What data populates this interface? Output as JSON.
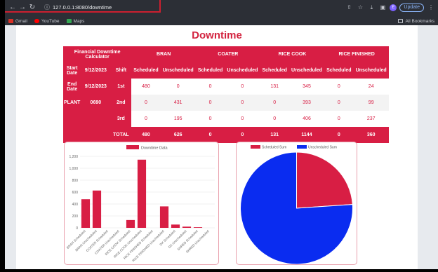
{
  "browser": {
    "url": "127.0.0.1:8080/downtime",
    "update_label": "Update",
    "profile_initial": "E",
    "bookmarks": [
      {
        "label": "Gmail",
        "color": "#d93025"
      },
      {
        "label": "YouTube",
        "color": "#ff0000"
      },
      {
        "label": "Maps",
        "color": "#34a853"
      }
    ],
    "all_bookmarks": "All Bookmarks"
  },
  "page": {
    "title": "Downtime"
  },
  "calculator": {
    "title": "Financial Downtime Calculator",
    "lines": [
      "BRAN",
      "COATER",
      "RICE COOK",
      "RICE FINISHED"
    ],
    "start_label": "Start Date",
    "start_date": "9/12/2023",
    "shift_label": "Shift",
    "scheduled": "Scheduled",
    "unscheduled": "Unscheduled",
    "end_label": "End Date",
    "end_date": "9/12/2023",
    "plant_label": "PLANT",
    "plant": "0690",
    "shifts": [
      {
        "name": "1st",
        "values": [
          "480",
          "0",
          "0",
          "0",
          "131",
          "345",
          "0",
          "24"
        ]
      },
      {
        "name": "2nd",
        "values": [
          "0",
          "431",
          "0",
          "0",
          "0",
          "393",
          "0",
          "99"
        ]
      },
      {
        "name": "3rd",
        "values": [
          "0",
          "195",
          "0",
          "0",
          "0",
          "406",
          "0",
          "237"
        ]
      }
    ],
    "total_label": "TOTAL",
    "totals": [
      "480",
      "626",
      "0",
      "0",
      "131",
      "1144",
      "0",
      "360"
    ]
  },
  "colors": {
    "crimson": "#d81e44",
    "blue": "#0a2cf0"
  },
  "chart_data": [
    {
      "type": "bar",
      "legend": [
        "Downtime Data"
      ],
      "categories": [
        "BRAN Scheduled",
        "BRAN Unscheduled",
        "COATER Scheduled",
        "COATER Unscheduled",
        "RICE COOK Scheduled",
        "RICE COOK Unscheduled",
        "RICE FINISHED Scheduled",
        "RICE FINISHED Unscheduled",
        "DX Scheduled",
        "DX Unscheduled",
        "SHRED Scheduled",
        "SHRED Unscheduled"
      ],
      "values": [
        480,
        626,
        0,
        0,
        131,
        1144,
        0,
        360,
        55,
        20,
        10,
        0
      ],
      "ylim": [
        0,
        1200
      ],
      "yticks": [
        "0",
        "200",
        "400",
        "600",
        "800",
        "1,000",
        "1,200"
      ],
      "grid": true,
      "legend_position": "top"
    },
    {
      "type": "pie",
      "legend": [
        "Scheduled Sum",
        "Unscheduled Sum"
      ],
      "labels": [
        "Scheduled Sum",
        "Unscheduled Sum"
      ],
      "values": [
        676,
        2150
      ],
      "legend_position": "top"
    }
  ]
}
